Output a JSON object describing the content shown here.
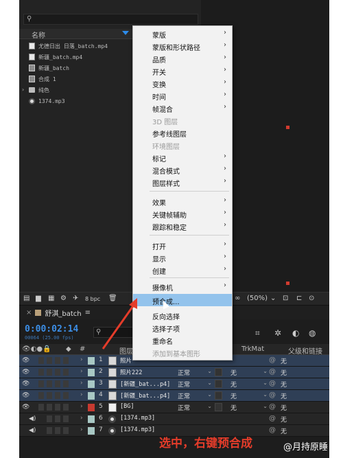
{
  "project": {
    "search_icon": "search-icon",
    "name_header": "名称",
    "items": [
      {
        "label": "尤德日出 日落_batch.mp4",
        "icon": "video-file-icon"
      },
      {
        "label": "新疆_batch.mp4",
        "icon": "video-file-icon"
      },
      {
        "label": "新疆_batch",
        "icon": "composition-icon"
      },
      {
        "label": "合成 1",
        "icon": "composition-icon"
      },
      {
        "label": "纯色",
        "icon": "folder-icon"
      },
      {
        "label": "1374.mp3",
        "icon": "audio-file-icon"
      }
    ]
  },
  "toolbar": {
    "bpc": "8 bpc",
    "zoom": "(50%)"
  },
  "timeline": {
    "tab_label": "舒淇_batch",
    "timecode": "0:00:02:14",
    "timecode_sub": "00064 (25.00 fps)",
    "columns": {
      "num": "#",
      "layer_name": "图层名称",
      "trkmat": "TrkMat",
      "parent": "父级和链接"
    },
    "rows": [
      {
        "num": "1",
        "name": "照片",
        "mode": "",
        "trkmat": "",
        "parent": "无",
        "color": "#a8c8c4",
        "type": "video",
        "selected": true
      },
      {
        "num": "2",
        "name": "照片222",
        "mode": "正常",
        "trkmat": "无",
        "parent": "无",
        "color": "#a8c8c4",
        "type": "video",
        "selected": false
      },
      {
        "num": "3",
        "name": "[新疆_bat...p4]",
        "mode": "正常",
        "trkmat": "无",
        "parent": "无",
        "color": "#a8c8c4",
        "type": "video",
        "selected": false
      },
      {
        "num": "4",
        "name": "[新疆_bat...p4]",
        "mode": "正常",
        "trkmat": "无",
        "parent": "无",
        "color": "#a8c8c4",
        "type": "video",
        "selected": false
      },
      {
        "num": "5",
        "name": "[BG]",
        "mode": "正常",
        "trkmat": "无",
        "parent": "无",
        "color": "#c73a30",
        "type": "solid",
        "selected": false
      },
      {
        "num": "6",
        "name": "[1374.mp3]",
        "mode": "",
        "trkmat": "",
        "parent": "无",
        "color": "#a8c8c4",
        "type": "audio",
        "selected": false
      },
      {
        "num": "7",
        "name": "[1374.mp3]",
        "mode": "",
        "trkmat": "",
        "parent": "无",
        "color": "#a8c8c4",
        "type": "audio",
        "selected": false
      }
    ]
  },
  "context_menu": {
    "items": [
      {
        "label": "蒙版",
        "submenu": true,
        "disabled": false
      },
      {
        "label": "蒙版和形状路径",
        "submenu": true,
        "disabled": false
      },
      {
        "label": "品质",
        "submenu": true,
        "disabled": false
      },
      {
        "label": "开关",
        "submenu": true,
        "disabled": false
      },
      {
        "label": "变换",
        "submenu": true,
        "disabled": false
      },
      {
        "label": "时间",
        "submenu": true,
        "disabled": false
      },
      {
        "label": "帧混合",
        "submenu": true,
        "disabled": false
      },
      {
        "label": "3D 图层",
        "submenu": false,
        "disabled": true
      },
      {
        "label": "参考线图层",
        "submenu": false,
        "disabled": false
      },
      {
        "label": "环境图层",
        "submenu": false,
        "disabled": true
      },
      {
        "label": "标记",
        "submenu": true,
        "disabled": false
      },
      {
        "label": "混合模式",
        "submenu": true,
        "disabled": false
      },
      {
        "label": "图层样式",
        "submenu": true,
        "disabled": false
      },
      {
        "label": "效果",
        "submenu": true,
        "disabled": false
      },
      {
        "label": "关键帧辅助",
        "submenu": true,
        "disabled": false
      },
      {
        "label": "跟踪和稳定",
        "submenu": true,
        "disabled": false
      },
      {
        "label": "打开",
        "submenu": true,
        "disabled": false
      },
      {
        "label": "显示",
        "submenu": true,
        "disabled": false
      },
      {
        "label": "创建",
        "submenu": true,
        "disabled": false
      },
      {
        "label": "摄像机",
        "submenu": true,
        "disabled": false
      },
      {
        "label": "预合成...",
        "submenu": false,
        "disabled": false,
        "highlighted": true
      },
      {
        "label": "反向选择",
        "submenu": false,
        "disabled": false
      },
      {
        "label": "选择子项",
        "submenu": false,
        "disabled": false
      },
      {
        "label": "重命名",
        "submenu": false,
        "disabled": false
      },
      {
        "label": "添加到基本图形",
        "submenu": false,
        "disabled": true
      }
    ]
  },
  "annotation": {
    "caption": "选中，右键预合成",
    "color": "#e43c2a"
  },
  "watermark": {
    "text": "@月持原睡"
  },
  "colors": {
    "accent_blue": "#3c8ee6",
    "menu_highlight": "#93c3ec",
    "selected_row": "#2f3f56"
  }
}
